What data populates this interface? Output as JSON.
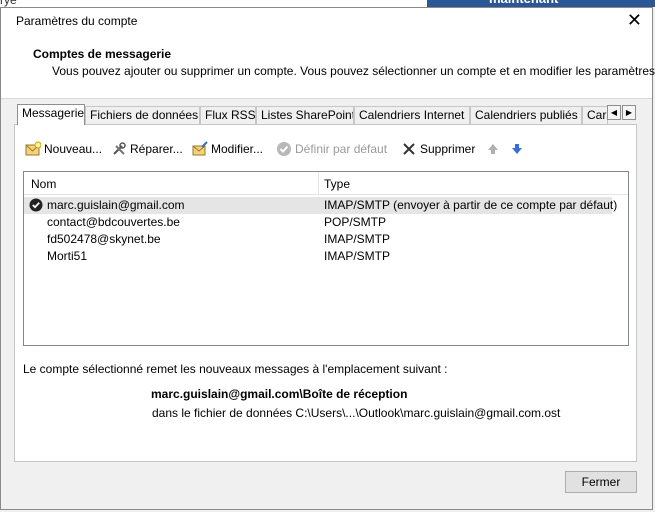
{
  "background": {
    "left_text": "rye",
    "right_banner": "maintenant"
  },
  "dialog": {
    "title": "Paramètres du compte",
    "close_glyph": "✕",
    "header_title": "Comptes de messagerie",
    "header_desc": "Vous pouvez ajouter ou supprimer un compte. Vous pouvez sélectionner un compte et en modifier les paramètres."
  },
  "tabs": [
    {
      "label": "Messagerie"
    },
    {
      "label": "Fichiers de données"
    },
    {
      "label": "Flux RSS"
    },
    {
      "label": "Listes SharePoint"
    },
    {
      "label": "Calendriers Internet"
    },
    {
      "label": "Calendriers publiés"
    },
    {
      "label": "Carnets"
    }
  ],
  "tab_scroll": {
    "left": "◀",
    "right": "▶"
  },
  "toolbar": {
    "new": "Nouveau...",
    "repair": "Réparer...",
    "modify": "Modifier...",
    "set_default": "Définir par défaut",
    "delete": "Supprimer"
  },
  "list": {
    "col_name": "Nom",
    "col_type": "Type",
    "rows": [
      {
        "name": "marc.guislain@gmail.com",
        "type": "IMAP/SMTP (envoyer à partir de ce compte par défaut)"
      },
      {
        "name": "contact@bdcouvertes.be",
        "type": "POP/SMTP"
      },
      {
        "name": "fd502478@skynet.be",
        "type": "IMAP/SMTP"
      },
      {
        "name": "Morti51",
        "type": "IMAP/SMTP"
      }
    ]
  },
  "info": {
    "text": "Le compte sélectionné remet les nouveaux messages à l'emplacement suivant :",
    "path": "marc.guislain@gmail.com\\Boîte de réception",
    "file": "dans le fichier de données C:\\Users\\...\\Outlook\\marc.guislain@gmail.com.ost"
  },
  "buttons": {
    "close": "Fermer"
  },
  "colors": {
    "accent_blue": "#2b5797",
    "selected_row": "#e5e5e5"
  }
}
